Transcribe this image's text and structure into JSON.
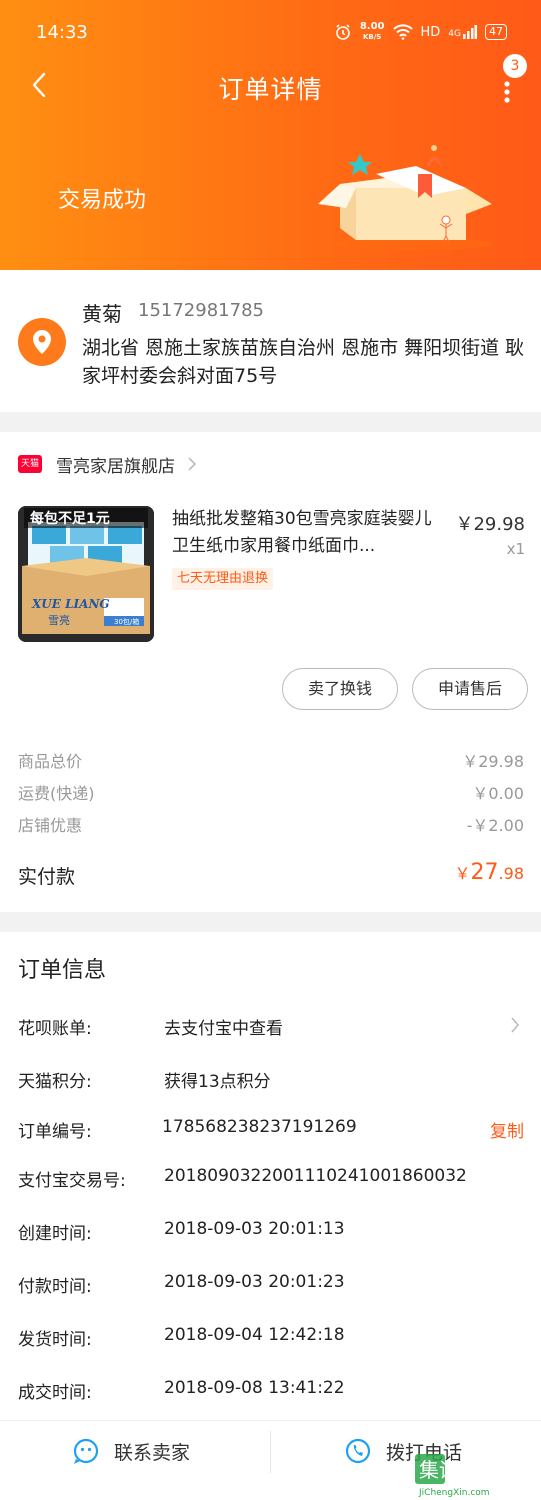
{
  "status_bar": {
    "time": "14:33",
    "net_speed_value": "8.00",
    "net_speed_unit": "KB/S",
    "hd": "HD",
    "signal": "4G",
    "battery": "47"
  },
  "nav": {
    "title": "订单详情",
    "badge_count": "3"
  },
  "order_status": "交易成功",
  "address": {
    "name": "黄菊",
    "phone": "15172981785",
    "line": "湖北省 恩施土家族苗族自治州 恩施市 舞阳坝街道 耿家坪村委会斜对面75号"
  },
  "shop": {
    "badge": "天猫",
    "name": "雪亮家居旗舰店"
  },
  "product": {
    "title": "抽纸批发整箱30包雪亮家庭装婴儿卫生纸巾家用餐巾纸面巾...",
    "price": "￥29.98",
    "quantity": "x1",
    "tag": "七天无理由退换",
    "image_caption": "每包不足1元",
    "image_brand": "XUE LIANG",
    "image_brand_cn": "雪亮",
    "image_box_text": "30包/箱"
  },
  "actions": {
    "resell": "卖了换钱",
    "aftersale": "申请售后"
  },
  "fees": [
    {
      "label": "商品总价",
      "value": "￥29.98"
    },
    {
      "label": "运费(快递)",
      "value": "￥0.00"
    },
    {
      "label": "店铺优惠",
      "value": "-￥2.00"
    }
  ],
  "payment": {
    "label": "实付款",
    "currency": "￥",
    "integer": "27",
    "decimal": ".98"
  },
  "order_info": {
    "title": "订单信息",
    "rows": [
      {
        "label": "花呗账单:",
        "value": "去支付宝中查看"
      },
      {
        "label": "天猫积分:",
        "value": "获得13点积分"
      },
      {
        "label": "订单编号:",
        "value": "178568238237191269"
      },
      {
        "label": "支付宝交易号:",
        "value": "2018090322001110241001860032"
      },
      {
        "label": "创建时间:",
        "value": "2018-09-03 20:01:13"
      },
      {
        "label": "付款时间:",
        "value": "2018-09-03 20:01:23"
      },
      {
        "label": "发货时间:",
        "value": "2018-09-04 12:42:18"
      },
      {
        "label": "成交时间:",
        "value": "2018-09-08 13:41:22"
      }
    ],
    "copy_label": "复制"
  },
  "bottom": {
    "contact": "联系卖家",
    "call": "拨打电话"
  },
  "watermark": {
    "text": "集诚信",
    "url": "JiChengXin.com"
  },
  "colors": {
    "accent": "#ff5a18",
    "header_start": "#ff8f12",
    "header_end": "#ff5a18",
    "tmall_red": "#ff0036"
  }
}
